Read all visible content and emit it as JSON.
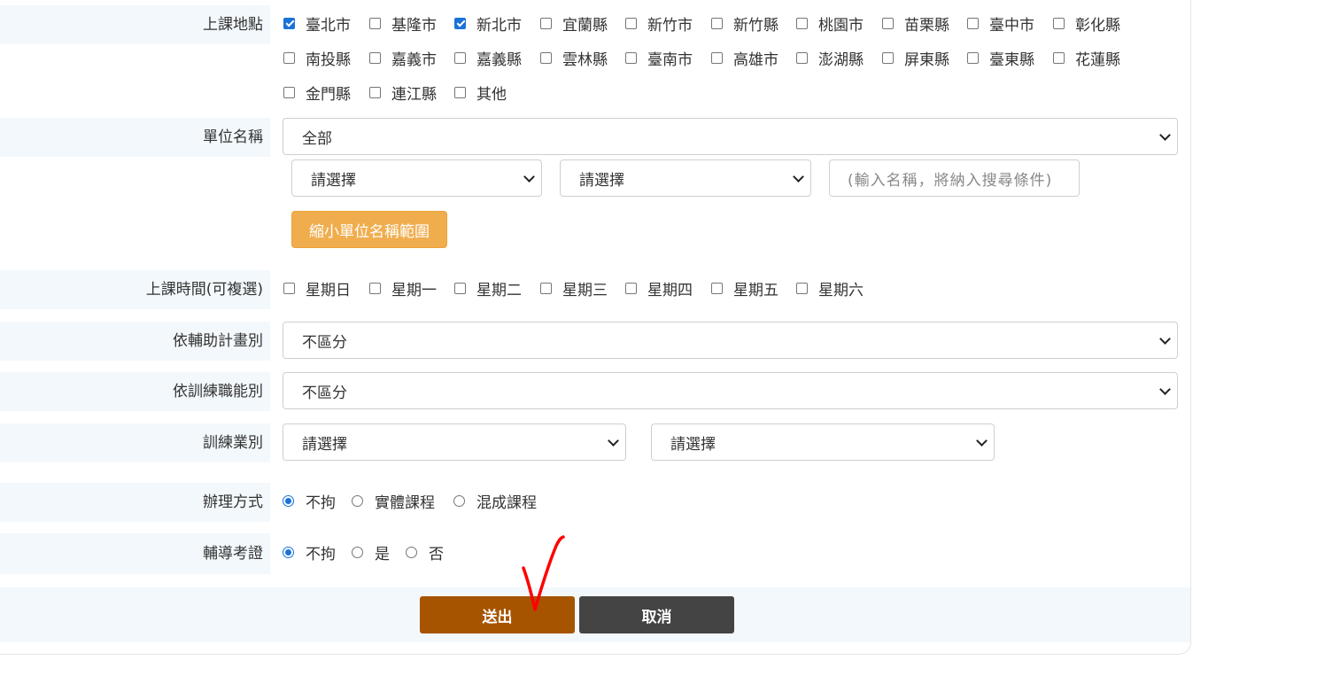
{
  "location": {
    "label": "上課地點",
    "options": [
      {
        "text": "臺北市",
        "checked": true
      },
      {
        "text": "基隆市",
        "checked": false
      },
      {
        "text": "新北市",
        "checked": true
      },
      {
        "text": "宜蘭縣",
        "checked": false
      },
      {
        "text": "新竹市",
        "checked": false
      },
      {
        "text": "新竹縣",
        "checked": false
      },
      {
        "text": "桃園市",
        "checked": false
      },
      {
        "text": "苗栗縣",
        "checked": false
      },
      {
        "text": "臺中市",
        "checked": false
      },
      {
        "text": "彰化縣",
        "checked": false
      },
      {
        "text": "南投縣",
        "checked": false
      },
      {
        "text": "嘉義市",
        "checked": false
      },
      {
        "text": "嘉義縣",
        "checked": false
      },
      {
        "text": "雲林縣",
        "checked": false
      },
      {
        "text": "臺南市",
        "checked": false
      },
      {
        "text": "高雄市",
        "checked": false
      },
      {
        "text": "澎湖縣",
        "checked": false
      },
      {
        "text": "屏東縣",
        "checked": false
      },
      {
        "text": "臺東縣",
        "checked": false
      },
      {
        "text": "花蓮縣",
        "checked": false
      },
      {
        "text": "金門縣",
        "checked": false
      },
      {
        "text": "連江縣",
        "checked": false
      },
      {
        "text": "其他",
        "checked": false
      }
    ]
  },
  "unit": {
    "label": "單位名稱",
    "main_select": "全部",
    "sub_select_1": "請選擇",
    "sub_select_2": "請選擇",
    "name_placeholder": "(輸入名稱，將納入搜尋條件)",
    "narrow_button": "縮小單位名稱範圍"
  },
  "schedule": {
    "label": "上課時間(可複選)",
    "options": [
      {
        "text": "星期日",
        "checked": false
      },
      {
        "text": "星期一",
        "checked": false
      },
      {
        "text": "星期二",
        "checked": false
      },
      {
        "text": "星期三",
        "checked": false
      },
      {
        "text": "星期四",
        "checked": false
      },
      {
        "text": "星期五",
        "checked": false
      },
      {
        "text": "星期六",
        "checked": false
      }
    ]
  },
  "subsidy": {
    "label": "依輔助計畫別",
    "value": "不區分"
  },
  "function": {
    "label": "依訓練職能別",
    "value": "不區分"
  },
  "industry": {
    "label": "訓練業別",
    "select_1": "請選擇",
    "select_2": "請選擇"
  },
  "method": {
    "label": "辦理方式",
    "options": [
      {
        "text": "不拘",
        "checked": true
      },
      {
        "text": "實體課程",
        "checked": false
      },
      {
        "text": "混成課程",
        "checked": false
      }
    ]
  },
  "certification": {
    "label": "輔導考證",
    "options": [
      {
        "text": "不拘",
        "checked": true
      },
      {
        "text": "是",
        "checked": false
      },
      {
        "text": "否",
        "checked": false
      }
    ]
  },
  "actions": {
    "submit": "送出",
    "cancel": "取消"
  },
  "colors": {
    "submit_bg": "#a65400",
    "cancel_bg": "#444444",
    "orange_button": "#f0ad4e",
    "check_blue": "#1a73d8",
    "annotation_red": "#ff0000"
  }
}
